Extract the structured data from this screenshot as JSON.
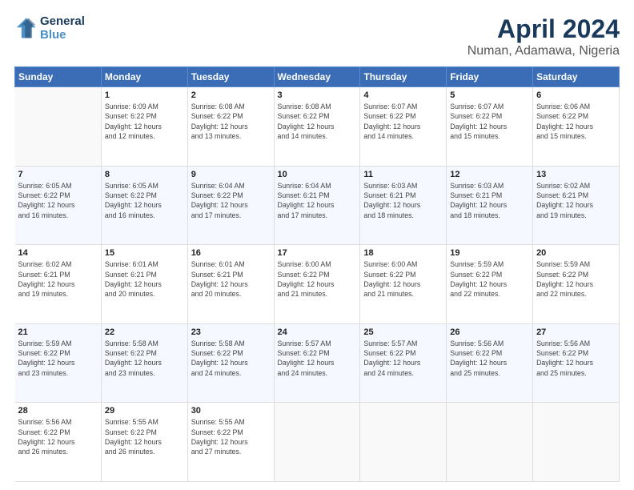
{
  "header": {
    "logo_line1": "General",
    "logo_line2": "Blue",
    "month": "April 2024",
    "location": "Numan, Adamawa, Nigeria"
  },
  "weekdays": [
    "Sunday",
    "Monday",
    "Tuesday",
    "Wednesday",
    "Thursday",
    "Friday",
    "Saturday"
  ],
  "weeks": [
    [
      {
        "day": "",
        "data": ""
      },
      {
        "day": "1",
        "data": "Sunrise: 6:09 AM\nSunset: 6:22 PM\nDaylight: 12 hours\nand 12 minutes."
      },
      {
        "day": "2",
        "data": "Sunrise: 6:08 AM\nSunset: 6:22 PM\nDaylight: 12 hours\nand 13 minutes."
      },
      {
        "day": "3",
        "data": "Sunrise: 6:08 AM\nSunset: 6:22 PM\nDaylight: 12 hours\nand 14 minutes."
      },
      {
        "day": "4",
        "data": "Sunrise: 6:07 AM\nSunset: 6:22 PM\nDaylight: 12 hours\nand 14 minutes."
      },
      {
        "day": "5",
        "data": "Sunrise: 6:07 AM\nSunset: 6:22 PM\nDaylight: 12 hours\nand 15 minutes."
      },
      {
        "day": "6",
        "data": "Sunrise: 6:06 AM\nSunset: 6:22 PM\nDaylight: 12 hours\nand 15 minutes."
      }
    ],
    [
      {
        "day": "7",
        "data": "Sunrise: 6:05 AM\nSunset: 6:22 PM\nDaylight: 12 hours\nand 16 minutes."
      },
      {
        "day": "8",
        "data": "Sunrise: 6:05 AM\nSunset: 6:22 PM\nDaylight: 12 hours\nand 16 minutes."
      },
      {
        "day": "9",
        "data": "Sunrise: 6:04 AM\nSunset: 6:22 PM\nDaylight: 12 hours\nand 17 minutes."
      },
      {
        "day": "10",
        "data": "Sunrise: 6:04 AM\nSunset: 6:21 PM\nDaylight: 12 hours\nand 17 minutes."
      },
      {
        "day": "11",
        "data": "Sunrise: 6:03 AM\nSunset: 6:21 PM\nDaylight: 12 hours\nand 18 minutes."
      },
      {
        "day": "12",
        "data": "Sunrise: 6:03 AM\nSunset: 6:21 PM\nDaylight: 12 hours\nand 18 minutes."
      },
      {
        "day": "13",
        "data": "Sunrise: 6:02 AM\nSunset: 6:21 PM\nDaylight: 12 hours\nand 19 minutes."
      }
    ],
    [
      {
        "day": "14",
        "data": "Sunrise: 6:02 AM\nSunset: 6:21 PM\nDaylight: 12 hours\nand 19 minutes."
      },
      {
        "day": "15",
        "data": "Sunrise: 6:01 AM\nSunset: 6:21 PM\nDaylight: 12 hours\nand 20 minutes."
      },
      {
        "day": "16",
        "data": "Sunrise: 6:01 AM\nSunset: 6:21 PM\nDaylight: 12 hours\nand 20 minutes."
      },
      {
        "day": "17",
        "data": "Sunrise: 6:00 AM\nSunset: 6:22 PM\nDaylight: 12 hours\nand 21 minutes."
      },
      {
        "day": "18",
        "data": "Sunrise: 6:00 AM\nSunset: 6:22 PM\nDaylight: 12 hours\nand 21 minutes."
      },
      {
        "day": "19",
        "data": "Sunrise: 5:59 AM\nSunset: 6:22 PM\nDaylight: 12 hours\nand 22 minutes."
      },
      {
        "day": "20",
        "data": "Sunrise: 5:59 AM\nSunset: 6:22 PM\nDaylight: 12 hours\nand 22 minutes."
      }
    ],
    [
      {
        "day": "21",
        "data": "Sunrise: 5:59 AM\nSunset: 6:22 PM\nDaylight: 12 hours\nand 23 minutes."
      },
      {
        "day": "22",
        "data": "Sunrise: 5:58 AM\nSunset: 6:22 PM\nDaylight: 12 hours\nand 23 minutes."
      },
      {
        "day": "23",
        "data": "Sunrise: 5:58 AM\nSunset: 6:22 PM\nDaylight: 12 hours\nand 24 minutes."
      },
      {
        "day": "24",
        "data": "Sunrise: 5:57 AM\nSunset: 6:22 PM\nDaylight: 12 hours\nand 24 minutes."
      },
      {
        "day": "25",
        "data": "Sunrise: 5:57 AM\nSunset: 6:22 PM\nDaylight: 12 hours\nand 24 minutes."
      },
      {
        "day": "26",
        "data": "Sunrise: 5:56 AM\nSunset: 6:22 PM\nDaylight: 12 hours\nand 25 minutes."
      },
      {
        "day": "27",
        "data": "Sunrise: 5:56 AM\nSunset: 6:22 PM\nDaylight: 12 hours\nand 25 minutes."
      }
    ],
    [
      {
        "day": "28",
        "data": "Sunrise: 5:56 AM\nSunset: 6:22 PM\nDaylight: 12 hours\nand 26 minutes."
      },
      {
        "day": "29",
        "data": "Sunrise: 5:55 AM\nSunset: 6:22 PM\nDaylight: 12 hours\nand 26 minutes."
      },
      {
        "day": "30",
        "data": "Sunrise: 5:55 AM\nSunset: 6:22 PM\nDaylight: 12 hours\nand 27 minutes."
      },
      {
        "day": "",
        "data": ""
      },
      {
        "day": "",
        "data": ""
      },
      {
        "day": "",
        "data": ""
      },
      {
        "day": "",
        "data": ""
      }
    ]
  ]
}
